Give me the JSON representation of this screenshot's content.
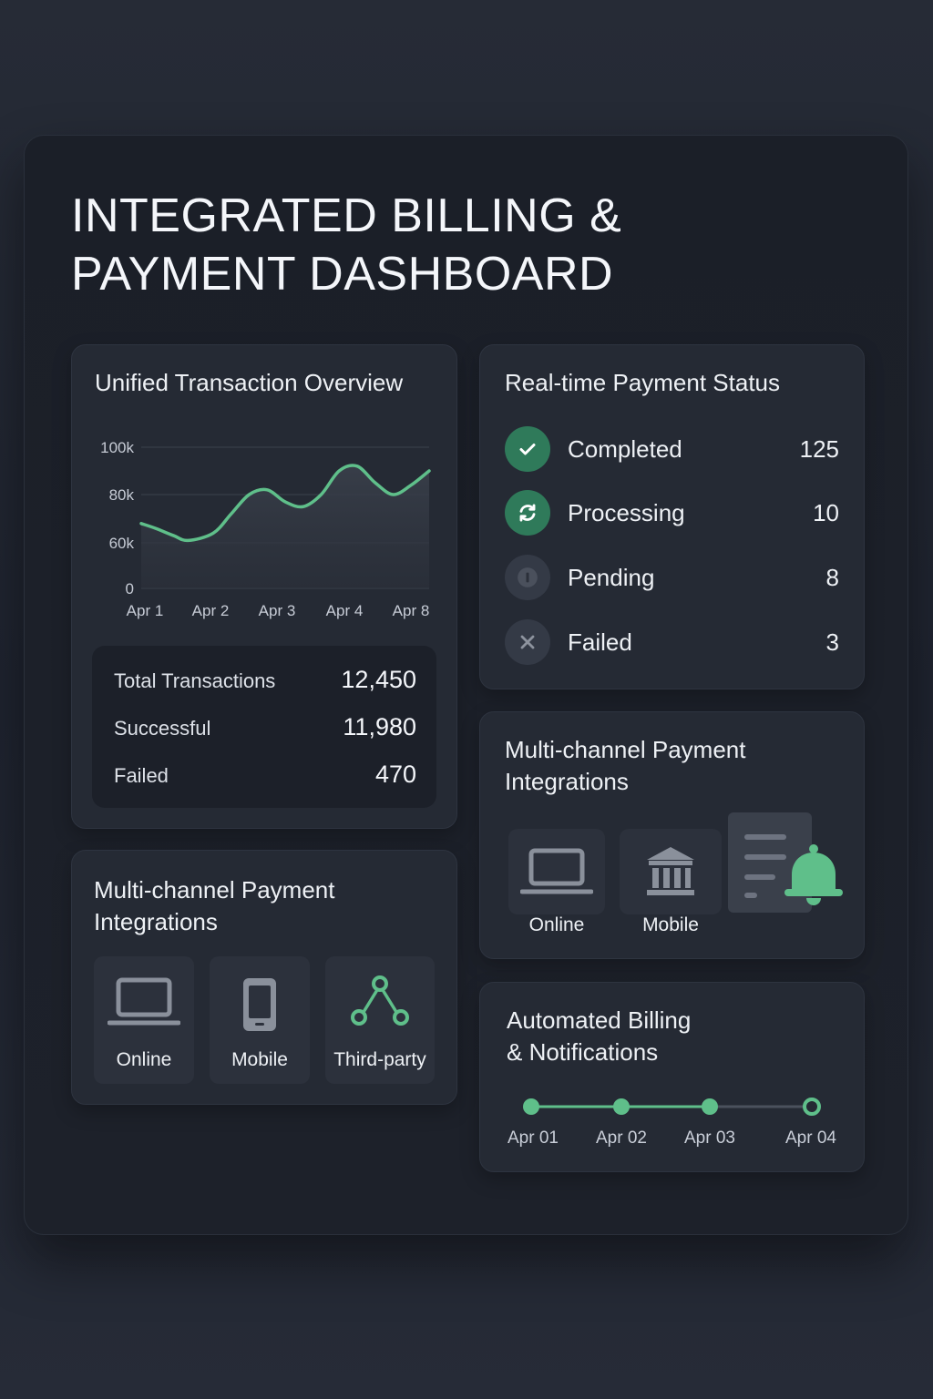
{
  "title": {
    "line1": "INTEGRATED BILLING &",
    "line2": "PAYMENT DASHBOARD"
  },
  "overview": {
    "title": "Unified Transaction Overview",
    "summary": [
      {
        "label": "Total Transactions",
        "value": "12,450"
      },
      {
        "label": "Successful",
        "value": "11,980"
      },
      {
        "label": "Failed",
        "value": "470"
      }
    ]
  },
  "chart_data": {
    "type": "area",
    "title": "",
    "xlabel": "",
    "ylabel": "",
    "x_ticks": [
      "Apr 1",
      "Apr 2",
      "Apr 3",
      "Apr 4",
      "Apr 8"
    ],
    "y_ticks": [
      "100k",
      "80k",
      "60k",
      "0"
    ],
    "grid": true,
    "series": [
      {
        "color": "#5fbf8a",
        "x": [
          0,
          0.2,
          0.45,
          0.65,
          1.0,
          1.25,
          1.5,
          1.75,
          2.0,
          2.25,
          2.5,
          2.75,
          3.0,
          3.25,
          3.5,
          3.75,
          4.0
        ],
        "y": [
          68,
          66,
          63,
          61,
          64,
          72,
          80,
          82,
          77,
          75,
          80,
          90,
          92,
          85,
          80,
          84,
          90
        ]
      }
    ]
  },
  "status": {
    "title": "Real-time Payment Status",
    "items": [
      {
        "label": "Completed",
        "count": "125",
        "icon": "check-icon"
      },
      {
        "label": "Processing",
        "count": "10",
        "icon": "refresh-icon"
      },
      {
        "label": "Pending",
        "count": "8",
        "icon": "pending-icon"
      },
      {
        "label": "Failed",
        "count": "3",
        "icon": "close-icon"
      }
    ]
  },
  "integrations_left": {
    "title_line1": "Multi-channel Payment",
    "title_line2": "Integrations",
    "channels": [
      {
        "label": "Online",
        "icon": "laptop-icon"
      },
      {
        "label": "Mobile",
        "icon": "mobile-icon"
      },
      {
        "label": "Third-party",
        "icon": "network-icon"
      }
    ]
  },
  "integrations_right": {
    "title_line1": "Multi-channel Payment",
    "title_line2": "Integrations",
    "channels": [
      {
        "label": "Online",
        "icon": "laptop-icon"
      },
      {
        "label": "Mobile",
        "icon": "bank-icon"
      }
    ],
    "extra_icon": "notification-document-icon"
  },
  "automated": {
    "title_line1": "Automated Billing",
    "title_line2": "& Notifications",
    "timeline": [
      "Apr 01",
      "Apr 02",
      "Apr 03",
      "Apr 04"
    ]
  },
  "colors": {
    "accent": "#5fbf8a",
    "accent_dark": "#2f7a5a",
    "card": "#252a34",
    "background": "#1b1f28"
  }
}
